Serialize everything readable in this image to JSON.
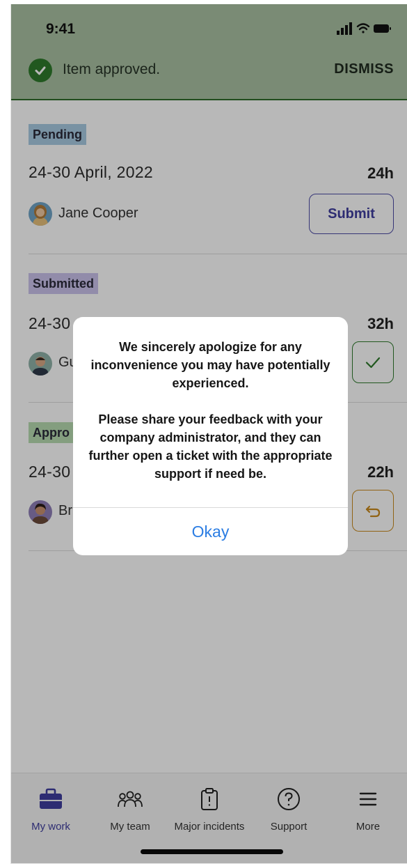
{
  "status_bar": {
    "time": "9:41"
  },
  "toast": {
    "message": "Item approved.",
    "dismiss_label": "DISMISS"
  },
  "timesheets": [
    {
      "status": "Pending",
      "date_range": "24-30 April, 2022",
      "hours": "24h",
      "person": "Jane Cooper",
      "action_label": "Submit"
    },
    {
      "status": "Submitted",
      "date_range": "24-30 April, 2022",
      "hours": "32h",
      "person": "Gu"
    },
    {
      "status": "Appro",
      "date_range": "24-30",
      "hours": "22h",
      "person": "Br"
    }
  ],
  "alert": {
    "paragraph1": "We sincerely apologize for any inconvenience you may have potentially experienced.",
    "paragraph2": "Please share your feedback with your company administrator, and they can further open a ticket with the appropriate support if need be.",
    "ok_label": "Okay"
  },
  "tabbar": {
    "tabs": [
      {
        "label": "My work",
        "icon": "briefcase-icon",
        "active": true
      },
      {
        "label": "My team",
        "icon": "team-icon",
        "active": false
      },
      {
        "label": "Major incidents",
        "icon": "clipboard-alert-icon",
        "active": false
      },
      {
        "label": "Support",
        "icon": "help-circle-icon",
        "active": false
      },
      {
        "label": "More",
        "icon": "menu-icon",
        "active": false
      }
    ]
  },
  "colors": {
    "accent": "#3f3e9e",
    "success": "#2f7a2c",
    "pending_badge": "#a8cbe2",
    "submitted_badge": "#cbc2ec",
    "approved_badge": "#b8dcb0",
    "return_button": "#c98a1d",
    "link_blue": "#2b7de3"
  }
}
